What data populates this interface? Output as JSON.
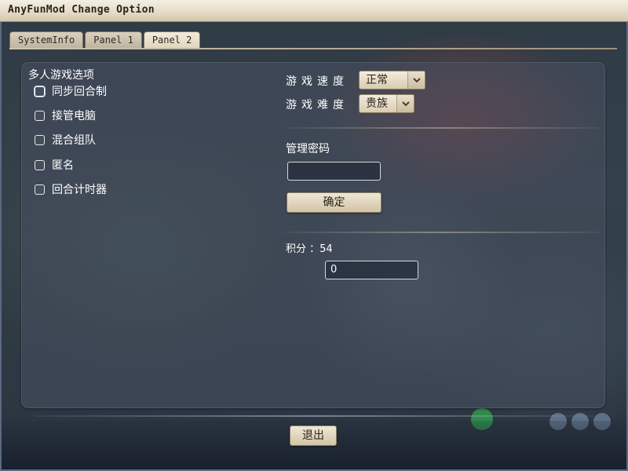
{
  "window": {
    "title": "AnyFunMod Change Option"
  },
  "tabs": [
    {
      "label": "SystemInfo",
      "active": false
    },
    {
      "label": "Panel 1",
      "active": false
    },
    {
      "label": "Panel 2",
      "active": true
    }
  ],
  "multiplayer": {
    "title": "多人游戏选项",
    "options": [
      {
        "label": "同步回合制",
        "checked": false,
        "focused": true
      },
      {
        "label": "接管电脑",
        "checked": false,
        "focused": false
      },
      {
        "label": "混合组队",
        "checked": false,
        "focused": false
      },
      {
        "label": "匿名",
        "checked": false,
        "focused": false
      },
      {
        "label": "回合计时器",
        "checked": false,
        "focused": false
      }
    ]
  },
  "game_speed": {
    "label": "游戏速度",
    "value": "正常"
  },
  "difficulty": {
    "label": "游戏难度",
    "value": "贵族"
  },
  "admin": {
    "label": "管理密码",
    "password_value": "",
    "confirm_label": "确定"
  },
  "score": {
    "label": "积分 ：54",
    "input_value": "0"
  },
  "footer": {
    "exit_label": "退出"
  },
  "colors": {
    "panel": "#464e5e",
    "button_face": "#e6dcc8",
    "text": "#ffffff"
  }
}
